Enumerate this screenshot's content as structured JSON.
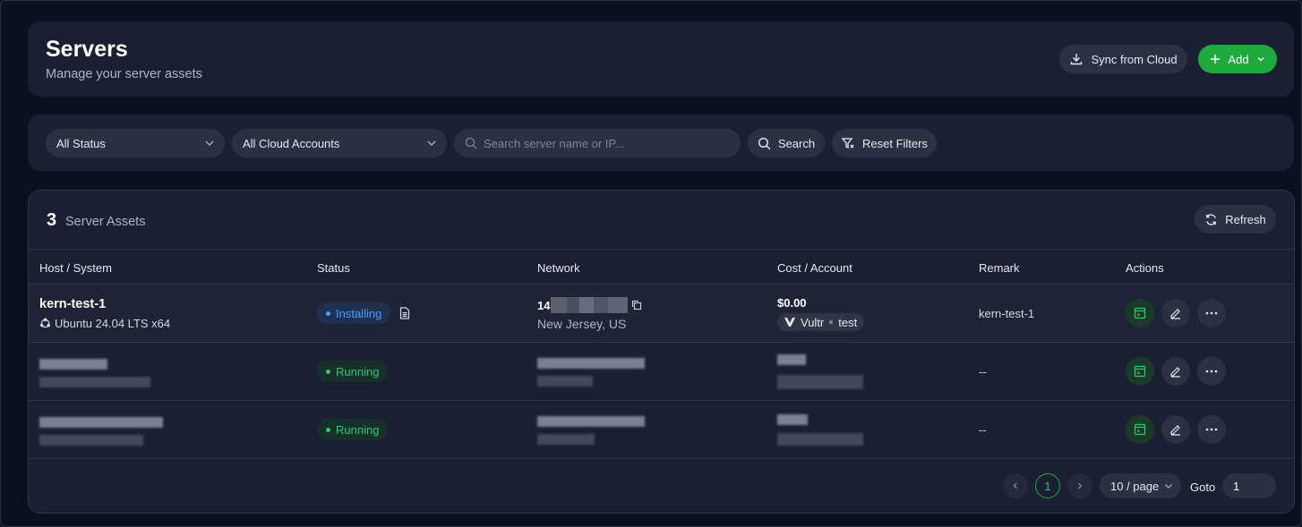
{
  "header": {
    "title": "Servers",
    "subtitle": "Manage your server assets",
    "sync_label": "Sync from Cloud",
    "add_label": "Add"
  },
  "filters": {
    "status_selected": "All Status",
    "cloud_selected": "All Cloud Accounts",
    "search_placeholder": "Search server name or IP...",
    "search_label": "Search",
    "reset_label": "Reset Filters"
  },
  "table": {
    "count": "3",
    "count_label": "Server Assets",
    "refresh_label": "Refresh",
    "columns": [
      "Host / System",
      "Status",
      "Network",
      "Cost / Account",
      "Remark",
      "Actions"
    ],
    "rows": [
      {
        "host": "kern-test-1",
        "os": "Ubuntu 24.04 LTS x64",
        "status": "Installing",
        "ip_prefix": "14",
        "location": "New Jersey, US",
        "cost": "$0.00",
        "provider": "Vultr",
        "account": "test",
        "remark": "kern-test-1"
      },
      {
        "status": "Running",
        "remark": "--"
      },
      {
        "status": "Running",
        "remark": "--"
      }
    ]
  },
  "pagination": {
    "current_page": "1",
    "page_size": "10 / page",
    "goto_label": "Goto",
    "goto_value": "1"
  },
  "colors": {
    "accent_green": "#1faa3e",
    "installing_blue": "#4d9dff",
    "running_green": "#2fc771",
    "card_bg": "#1a2032"
  }
}
